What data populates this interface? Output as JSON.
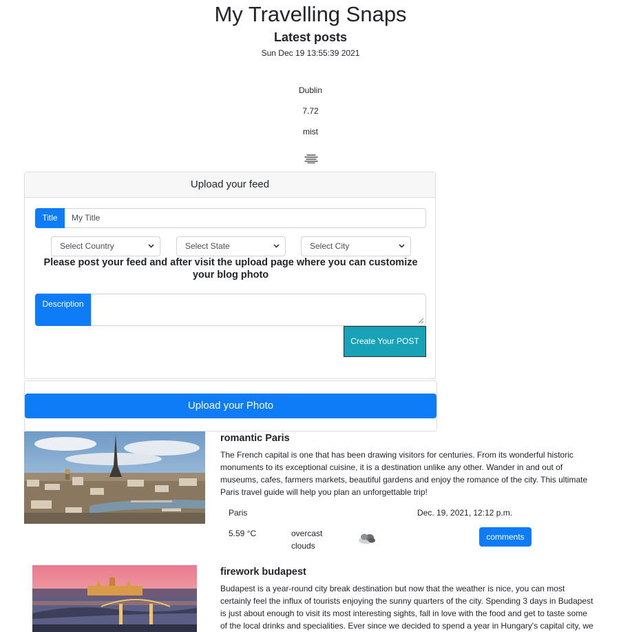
{
  "header": {
    "site_title": "My Travelling Snaps",
    "subtitle": "Latest posts",
    "datetime": "Sun Dec 19 13:55:39 2021"
  },
  "weather": {
    "city": "Dublin",
    "temp": "7.72",
    "description": "mist",
    "icon": "mist-icon"
  },
  "feed_form": {
    "header": "Upload your feed",
    "title_label": "Title",
    "title_value": "My Title",
    "country_select": "Select Country",
    "state_select": "Select State",
    "city_select": "Select City",
    "instructions": "Please post your feed and after visit the upload page where you can customize your blog photo",
    "description_label": "Description",
    "description_value": "",
    "create_button": "Create Your POST"
  },
  "photo_upload": {
    "button": "Upload your Photo"
  },
  "posts": [
    {
      "title": "romantic Paris",
      "body": "The French capital is one that has been drawing visitors for centuries. From its wonderful historic monuments to its exceptional cuisine, it is a destination unlike any other. Wander in and out of museums, cafes, farmers markets, beautiful gardens and enjoy the romance of the city. This ultimate Paris travel guide will help you plan an unforgettable trip!",
      "city": "Paris",
      "date": "Dec. 19, 2021, 12:12 p.m.",
      "temp": "5.59 °C",
      "weather": "overcast clouds",
      "weather_icon": "cloud-icon",
      "comments_label": "comments"
    },
    {
      "title": "firework budapest",
      "body": "Budapest is a year-round city break destination but now that the weather is nice, you can most certainly feel the influx of tourists enjoying the sunny quarters of the city. Spending 3 days in Budapest is just about enough to visit its most interesting sights, fall in love with the food and get to taste some of the local drinks and specialities. Ever since we decided to spend a year in Hungary's capital city, we"
    }
  ],
  "colors": {
    "primary": "#0d7cf6",
    "info": "#17a2b8",
    "border": "#dcdcdc"
  }
}
